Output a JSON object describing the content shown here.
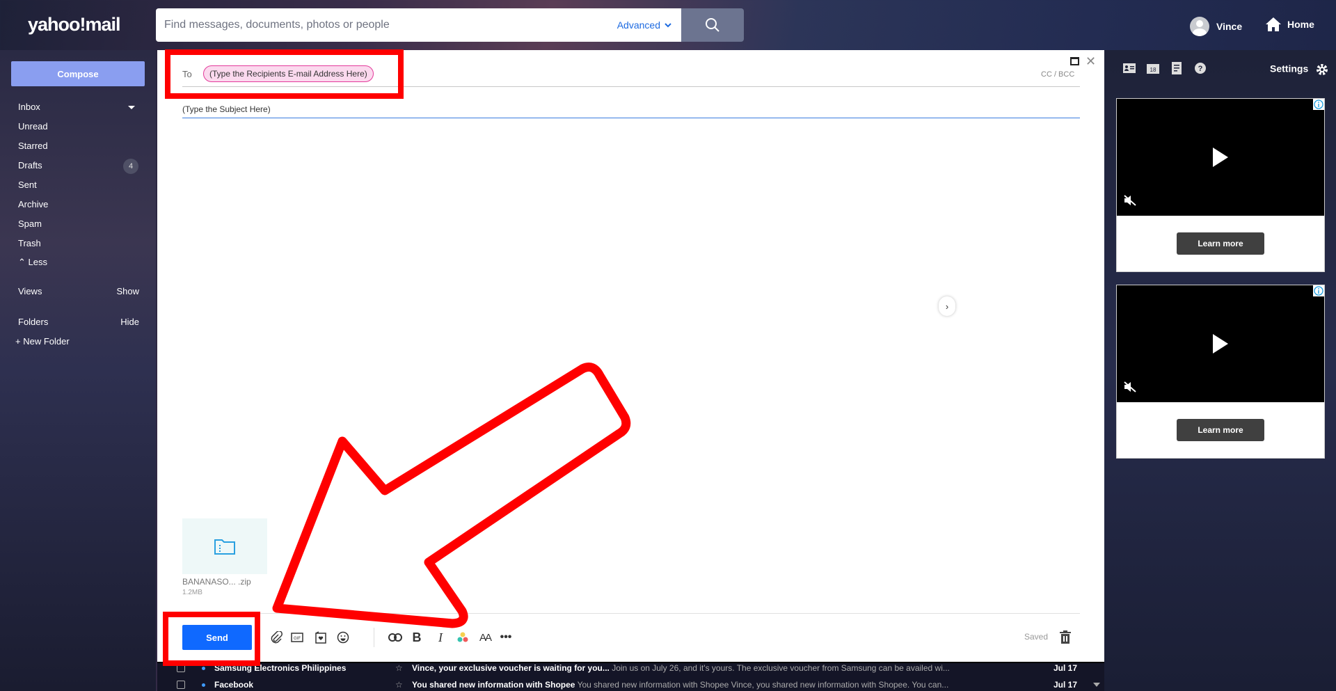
{
  "header": {
    "logo": "yahoo!mail",
    "search_placeholder": "Find messages, documents, photos or people",
    "advanced_label": "Advanced",
    "user_name": "Vince",
    "home_label": "Home"
  },
  "sidebar": {
    "compose_label": "Compose",
    "items": [
      {
        "label": "Inbox"
      },
      {
        "label": "Unread"
      },
      {
        "label": "Starred"
      },
      {
        "label": "Drafts",
        "badge": "4"
      },
      {
        "label": "Sent"
      },
      {
        "label": "Archive"
      },
      {
        "label": "Spam"
      },
      {
        "label": "Trash"
      }
    ],
    "less_label": "Less",
    "views_label": "Views",
    "views_action": "Show",
    "folders_label": "Folders",
    "folders_action": "Hide",
    "new_folder_label": "New Folder"
  },
  "composer": {
    "to_label": "To",
    "recipient": "(Type the Recipients E-mail Address Here)",
    "cc_bcc_label": "CC / BCC",
    "subject": "(Type the Subject Here)",
    "attachment": {
      "name": "BANANASO...  .zip",
      "size": "1.2MB"
    },
    "send_label": "Send",
    "status": "Saved",
    "toolbar_icons": [
      "attach-icon",
      "gif-icon",
      "stationery-icon",
      "emoji-icon",
      "link-icon",
      "bold-icon",
      "italic-icon",
      "color-icon",
      "font-size-icon",
      "more-icon"
    ]
  },
  "right_panel": {
    "settings_label": "Settings",
    "ads": [
      {
        "cta": "Learn more"
      },
      {
        "cta": "Learn more"
      }
    ]
  },
  "mail_list": [
    {
      "sender": "Samsung Electronics Philippines",
      "subject": "Vince, your exclusive voucher is waiting for you...",
      "preview": "Join us on July 26, and it's yours.  The exclusive voucher from Samsung can be availed wi...",
      "date": "Jul 17"
    },
    {
      "sender": "Facebook",
      "subject": "You shared new information with Shopee",
      "preview": "You shared new information with Shopee Vince, you shared new information with Shopee. You can...",
      "date": "Jul 17"
    }
  ],
  "colors": {
    "accent": "#0f69ff",
    "compose": "#8a9ef0",
    "annotation": "#ff0000",
    "chip_border": "#e33a9a"
  }
}
